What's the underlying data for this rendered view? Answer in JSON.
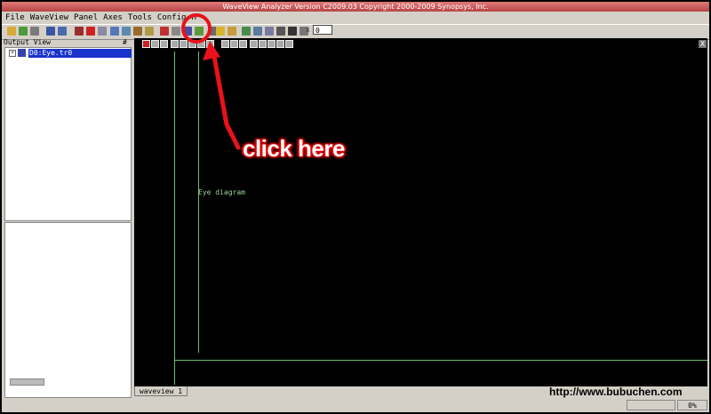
{
  "window": {
    "title": "WaveView Analyzer Version C2009.03 Copyright 2000-2009 Synopsys, Inc."
  },
  "menu": [
    "File",
    "WaveView",
    "Panel",
    "Axes",
    "Tools",
    "Config",
    "H"
  ],
  "toolbar": {
    "zoom_label": "x",
    "zoom_value": "0"
  },
  "output_view": {
    "title": "Output View",
    "pin": "#",
    "tree": [
      {
        "expander": "+",
        "label": "D0:Eye.tr0"
      }
    ]
  },
  "plot": {
    "panel_label": "Eye diagram",
    "close": "X",
    "grid_color": "#6fbf6f"
  },
  "tabs": [
    {
      "label": "waveview 1"
    }
  ],
  "status": {
    "zoom": "0%"
  },
  "watermark": "http://www.bubuchen.com",
  "annotation": {
    "text": "click here",
    "color": "#e8121a"
  }
}
